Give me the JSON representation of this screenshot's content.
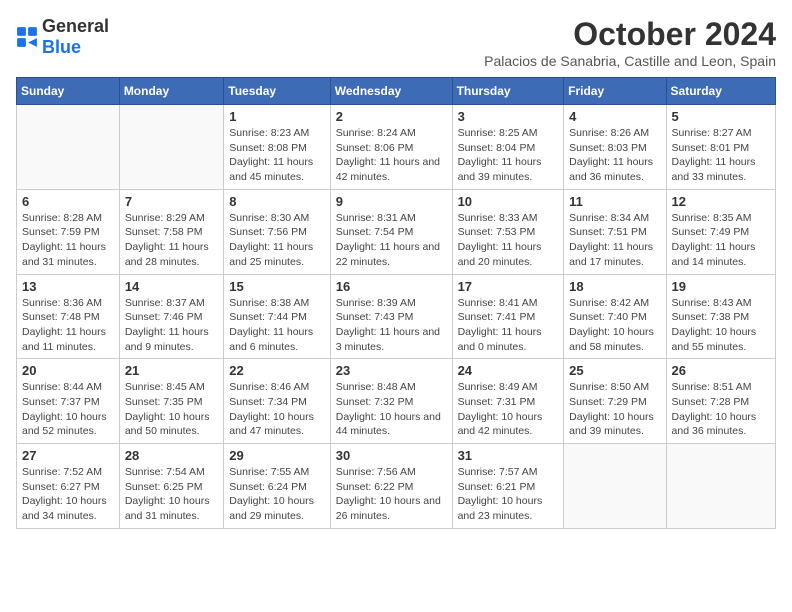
{
  "logo": {
    "general": "General",
    "blue": "Blue"
  },
  "title": "October 2024",
  "subtitle": "Palacios de Sanabria, Castille and Leon, Spain",
  "weekdays": [
    "Sunday",
    "Monday",
    "Tuesday",
    "Wednesday",
    "Thursday",
    "Friday",
    "Saturday"
  ],
  "weeks": [
    [
      {
        "day": "",
        "info": ""
      },
      {
        "day": "",
        "info": ""
      },
      {
        "day": "1",
        "info": "Sunrise: 8:23 AM\nSunset: 8:08 PM\nDaylight: 11 hours and 45 minutes."
      },
      {
        "day": "2",
        "info": "Sunrise: 8:24 AM\nSunset: 8:06 PM\nDaylight: 11 hours and 42 minutes."
      },
      {
        "day": "3",
        "info": "Sunrise: 8:25 AM\nSunset: 8:04 PM\nDaylight: 11 hours and 39 minutes."
      },
      {
        "day": "4",
        "info": "Sunrise: 8:26 AM\nSunset: 8:03 PM\nDaylight: 11 hours and 36 minutes."
      },
      {
        "day": "5",
        "info": "Sunrise: 8:27 AM\nSunset: 8:01 PM\nDaylight: 11 hours and 33 minutes."
      }
    ],
    [
      {
        "day": "6",
        "info": "Sunrise: 8:28 AM\nSunset: 7:59 PM\nDaylight: 11 hours and 31 minutes."
      },
      {
        "day": "7",
        "info": "Sunrise: 8:29 AM\nSunset: 7:58 PM\nDaylight: 11 hours and 28 minutes."
      },
      {
        "day": "8",
        "info": "Sunrise: 8:30 AM\nSunset: 7:56 PM\nDaylight: 11 hours and 25 minutes."
      },
      {
        "day": "9",
        "info": "Sunrise: 8:31 AM\nSunset: 7:54 PM\nDaylight: 11 hours and 22 minutes."
      },
      {
        "day": "10",
        "info": "Sunrise: 8:33 AM\nSunset: 7:53 PM\nDaylight: 11 hours and 20 minutes."
      },
      {
        "day": "11",
        "info": "Sunrise: 8:34 AM\nSunset: 7:51 PM\nDaylight: 11 hours and 17 minutes."
      },
      {
        "day": "12",
        "info": "Sunrise: 8:35 AM\nSunset: 7:49 PM\nDaylight: 11 hours and 14 minutes."
      }
    ],
    [
      {
        "day": "13",
        "info": "Sunrise: 8:36 AM\nSunset: 7:48 PM\nDaylight: 11 hours and 11 minutes."
      },
      {
        "day": "14",
        "info": "Sunrise: 8:37 AM\nSunset: 7:46 PM\nDaylight: 11 hours and 9 minutes."
      },
      {
        "day": "15",
        "info": "Sunrise: 8:38 AM\nSunset: 7:44 PM\nDaylight: 11 hours and 6 minutes."
      },
      {
        "day": "16",
        "info": "Sunrise: 8:39 AM\nSunset: 7:43 PM\nDaylight: 11 hours and 3 minutes."
      },
      {
        "day": "17",
        "info": "Sunrise: 8:41 AM\nSunset: 7:41 PM\nDaylight: 11 hours and 0 minutes."
      },
      {
        "day": "18",
        "info": "Sunrise: 8:42 AM\nSunset: 7:40 PM\nDaylight: 10 hours and 58 minutes."
      },
      {
        "day": "19",
        "info": "Sunrise: 8:43 AM\nSunset: 7:38 PM\nDaylight: 10 hours and 55 minutes."
      }
    ],
    [
      {
        "day": "20",
        "info": "Sunrise: 8:44 AM\nSunset: 7:37 PM\nDaylight: 10 hours and 52 minutes."
      },
      {
        "day": "21",
        "info": "Sunrise: 8:45 AM\nSunset: 7:35 PM\nDaylight: 10 hours and 50 minutes."
      },
      {
        "day": "22",
        "info": "Sunrise: 8:46 AM\nSunset: 7:34 PM\nDaylight: 10 hours and 47 minutes."
      },
      {
        "day": "23",
        "info": "Sunrise: 8:48 AM\nSunset: 7:32 PM\nDaylight: 10 hours and 44 minutes."
      },
      {
        "day": "24",
        "info": "Sunrise: 8:49 AM\nSunset: 7:31 PM\nDaylight: 10 hours and 42 minutes."
      },
      {
        "day": "25",
        "info": "Sunrise: 8:50 AM\nSunset: 7:29 PM\nDaylight: 10 hours and 39 minutes."
      },
      {
        "day": "26",
        "info": "Sunrise: 8:51 AM\nSunset: 7:28 PM\nDaylight: 10 hours and 36 minutes."
      }
    ],
    [
      {
        "day": "27",
        "info": "Sunrise: 7:52 AM\nSunset: 6:27 PM\nDaylight: 10 hours and 34 minutes."
      },
      {
        "day": "28",
        "info": "Sunrise: 7:54 AM\nSunset: 6:25 PM\nDaylight: 10 hours and 31 minutes."
      },
      {
        "day": "29",
        "info": "Sunrise: 7:55 AM\nSunset: 6:24 PM\nDaylight: 10 hours and 29 minutes."
      },
      {
        "day": "30",
        "info": "Sunrise: 7:56 AM\nSunset: 6:22 PM\nDaylight: 10 hours and 26 minutes."
      },
      {
        "day": "31",
        "info": "Sunrise: 7:57 AM\nSunset: 6:21 PM\nDaylight: 10 hours and 23 minutes."
      },
      {
        "day": "",
        "info": ""
      },
      {
        "day": "",
        "info": ""
      }
    ]
  ]
}
